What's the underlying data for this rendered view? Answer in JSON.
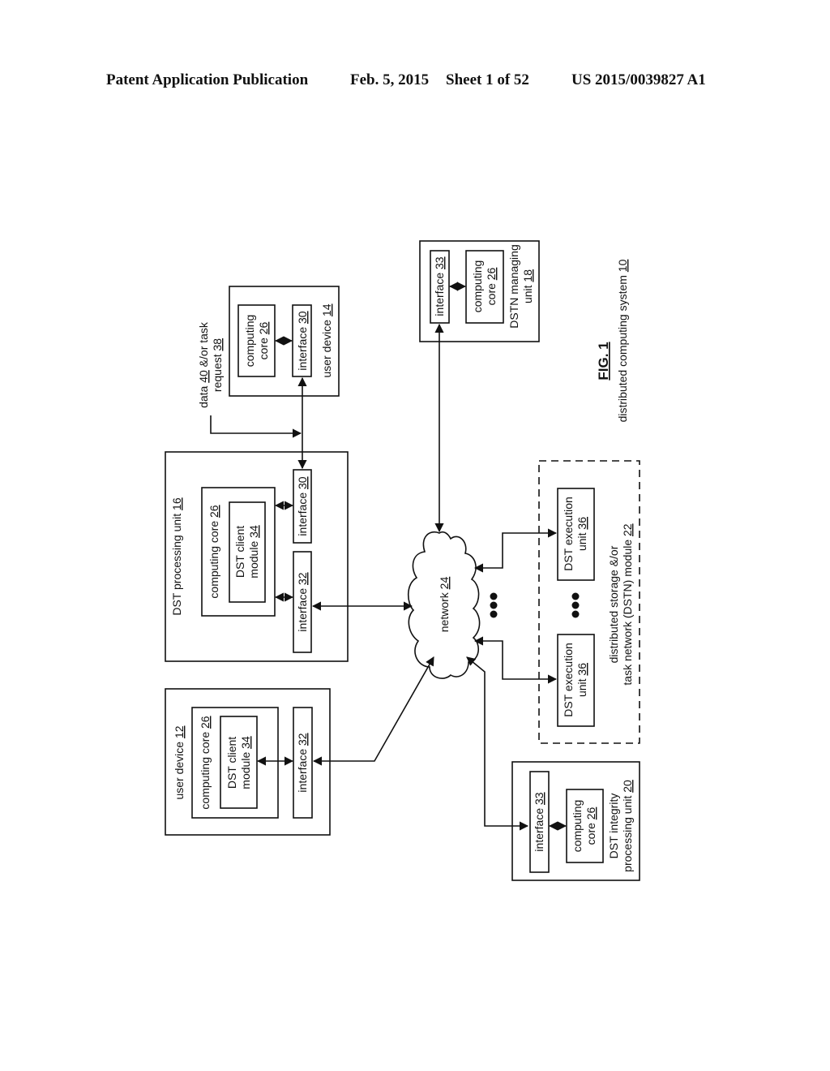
{
  "header": {
    "publication": "Patent Application Publication",
    "date": "Feb. 5, 2015",
    "sheet": "Sheet 1 of 52",
    "number": "US 2015/0039827 A1"
  },
  "figure": {
    "label": "FIG. 1",
    "caption_text": "distributed computing system",
    "caption_ref": "10"
  },
  "user_device_12": {
    "title": "user device",
    "ref": "12",
    "core": "computing core",
    "core_ref": "26",
    "module_l1": "DST client",
    "module_l2": "module",
    "module_ref": "34",
    "iface": "interface",
    "iface_ref": "32"
  },
  "dst_processing_unit_16": {
    "title": "DST processing unit",
    "ref": "16",
    "core": "computing core",
    "core_ref": "26",
    "module_l1": "DST client",
    "module_l2": "module",
    "module_ref": "34",
    "iface_a": "interface",
    "iface_a_ref": "30",
    "iface_b": "interface",
    "iface_b_ref": "32"
  },
  "user_device_14": {
    "title": "user device",
    "ref": "14",
    "core_l1": "computing",
    "core_l2": "core",
    "core_ref": "26",
    "iface": "interface",
    "iface_ref": "30"
  },
  "request": {
    "l1_a": "data",
    "l1_ref": "40",
    "l1_b": "&/or task",
    "l2": "request",
    "l2_ref": "38"
  },
  "dstn_managing_unit_18": {
    "title_l1": "DSTN managing",
    "title_l2": "unit",
    "ref": "18",
    "iface": "interface",
    "iface_ref": "33",
    "core_l1": "computing",
    "core_l2": "core",
    "core_ref": "26"
  },
  "network": {
    "label": "network",
    "ref": "24"
  },
  "dstn_module_22": {
    "l1": "distributed storage &/or",
    "l2": "task network (DSTN) module",
    "ref": "22",
    "exec_l1": "DST execution",
    "exec_l2": "unit",
    "exec_ref": "36"
  },
  "dst_integrity_unit_20": {
    "title_l1": "DST integrity",
    "title_l2": "processing unit",
    "ref": "20",
    "iface": "interface",
    "iface_ref": "33",
    "core_l1": "computing",
    "core_l2": "core",
    "core_ref": "26"
  }
}
